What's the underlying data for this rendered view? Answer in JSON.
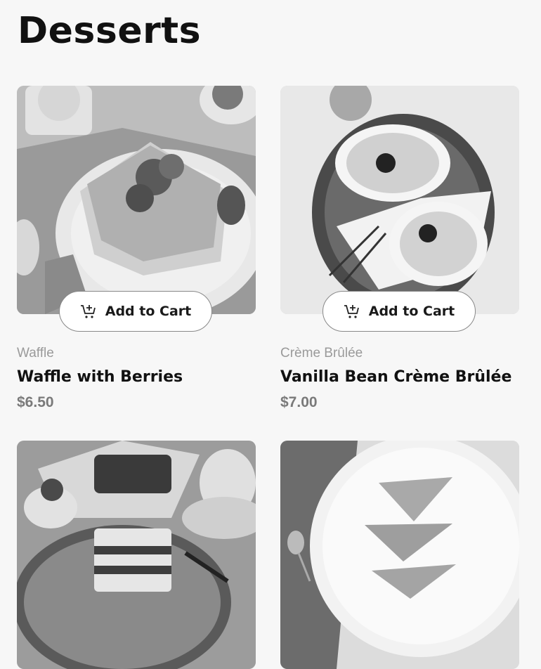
{
  "page": {
    "title": "Desserts"
  },
  "products": [
    {
      "category": "Waffle",
      "name": "Waffle with Berries",
      "price": "$6.50",
      "button": "Add to Cart"
    },
    {
      "category": "Crème Brûlée",
      "name": "Vanilla Bean Crème Brûlée",
      "price": "$7.00",
      "button": "Add to Cart"
    },
    {
      "category": "",
      "name": "",
      "price": "",
      "button": ""
    },
    {
      "category": "",
      "name": "",
      "price": "",
      "button": ""
    }
  ],
  "icons": {
    "cart": "cart-add-icon"
  }
}
